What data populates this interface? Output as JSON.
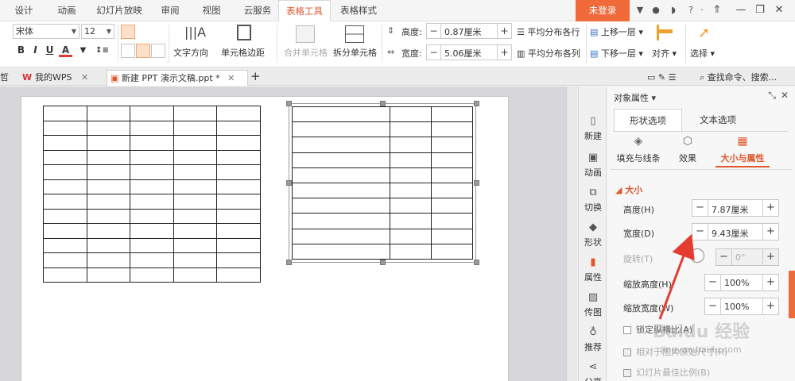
{
  "menubar": {
    "tabs": [
      "设计",
      "动画",
      "幻灯片放映",
      "审阅",
      "视图",
      "云服务",
      "表格工具",
      "表格样式"
    ],
    "active_tab": "表格工具",
    "login": "未登录",
    "help": "?"
  },
  "ribbon": {
    "font_name": "宋体",
    "font_size": "12",
    "bold": "B",
    "italic": "I",
    "underline": "U",
    "font_color": "A",
    "text_direction": "文字方向",
    "cell_margin": "单元格边距",
    "merge_cells": "合并单元格",
    "split_cells": "拆分单元格",
    "height_label": "高度:",
    "height_value": "0.87厘米",
    "width_label": "宽度:",
    "width_value": "5.06厘米",
    "dist_rows": "平均分布各行",
    "dist_cols": "平均分布各列",
    "bring_forward": "上移一层",
    "send_backward": "下移一层",
    "align": "对齐",
    "select": "选择"
  },
  "doctabs": {
    "partial": "哲",
    "wps": "我的WPS",
    "doc": "新建 PPT 演示文稿.ppt *",
    "new": "+",
    "search": "查找命令、搜索..."
  },
  "sidebar": {
    "items": [
      "新建",
      "动画",
      "切换",
      "形状",
      "属性",
      "传图",
      "推荐",
      "分享"
    ]
  },
  "panel": {
    "title": "对象属性",
    "tabs": [
      "形状选项",
      "文本选项"
    ],
    "subtabs": [
      "填充与线条",
      "效果",
      "大小与属性"
    ],
    "section": "大小",
    "height_label": "高度(H)",
    "height_value": "7.87厘米",
    "width_label": "宽度(D)",
    "width_value": "9.43厘米",
    "rotate_label": "旋转(T)",
    "rotate_value": "0°",
    "scale_h_label": "缩放高度(H)",
    "scale_h_value": "100%",
    "scale_w_label": "缩放宽度(W)",
    "scale_w_value": "100%",
    "lock_ratio": "锁定纵横比(A)",
    "relative_original": "相对于图片原始尺寸(R)",
    "best_fit": "幻灯片最佳比例(B)"
  },
  "watermark": {
    "text": "Baidu 经验",
    "url": "jingyan.baidu.com"
  },
  "tables": {
    "left": {
      "rows": 12,
      "cols": 5
    },
    "right": {
      "rows": 10,
      "cols": 3
    }
  },
  "colors": {
    "accent": "#e0572c",
    "login_bg": "#f06a3a",
    "arrow": "#e63b30"
  }
}
